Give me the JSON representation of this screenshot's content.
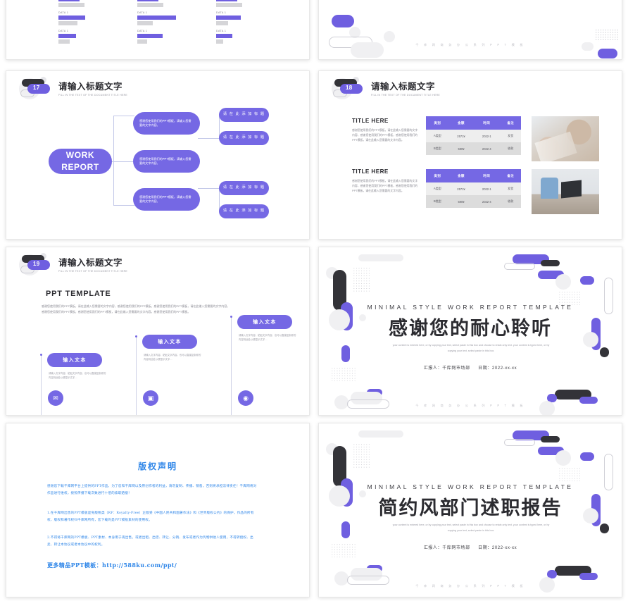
{
  "deck": {
    "footer_brand": "千 库 网 商 务 办 公 系 列 P P T 模 板"
  },
  "slide_chart": {
    "groups": [
      {
        "label": "DATA 1",
        "purple_pct": 52,
        "gray_pct": 36
      },
      {
        "label": "DATA 1",
        "purple_pct": 74,
        "gray_pct": 30
      },
      {
        "label": "DATA 1",
        "purple_pct": 47,
        "gray_pct": 23
      }
    ]
  },
  "slide17": {
    "number": "17",
    "title": "请输入标题文字",
    "subtitle": "FILL IN THE TEXT OF THE DOCUMENT TITLE HERE",
    "root": "WORK REPORT",
    "branches": [
      {
        "text": "感谢您使用我们的PPT模板，请输入您需要的文字内容。",
        "leaves": [
          "请 在 此 添 加 标 题",
          "请 在 此 添 加 标 题"
        ]
      },
      {
        "text": "感谢您使用我们的PPT模板，请输入您需要的文字内容。",
        "leaves": []
      },
      {
        "text": "感谢您使用我们的PPT模板，请输入您需要的文字内容。",
        "leaves": [
          "请 在 此 添 加 标 题",
          "请 在 此 添 加 标 题"
        ]
      }
    ]
  },
  "slide18": {
    "number": "18",
    "title": "请输入标题文字",
    "subtitle": "FILL IN THE TEXT OF THE DOCUMENT TITLE HERE",
    "blocks": [
      {
        "heading": "TITLE HERE",
        "paragraph": "感谢您使用我们的PPT模板，请在此输入您需要的文字内容，感谢您使用我们的PPT模板，感谢您使用我们的PPT模板，请在此输入您需要的文字内容。",
        "table": {
          "headers": [
            "类别",
            "金额",
            "时间",
            "备注"
          ],
          "rows": [
            [
              "A类型",
              "2571¥",
              "2022-1",
              "发货"
            ],
            [
              "B类型",
              "590¥",
              "2022-4",
              "收款"
            ]
          ]
        }
      },
      {
        "heading": "TITLE HERE",
        "paragraph": "感谢您使用我们的PPT模板，请在此输入您需要的文字内容，感谢您使用我们的PPT模板，感谢您使用我们的PPT模板，请在此输入您需要的文字内容。",
        "table": {
          "headers": [
            "类别",
            "金额",
            "时间",
            "备注"
          ],
          "rows": [
            [
              "A类型",
              "2571¥",
              "2022-1",
              "发货"
            ],
            [
              "B类型",
              "590¥",
              "2022-4",
              "收款"
            ]
          ]
        }
      }
    ]
  },
  "slide19": {
    "number": "19",
    "title": "请输入标题文字",
    "subtitle": "FILL IN THE TEXT OF THE DOCUMENT TITLE HERE",
    "heading": "PPT TEMPLATE",
    "paragraph": "感谢您使用我们的PPT模板，请在此输入您需要的文字内容，感谢您使用我们的PPT模板。感谢您使用我们的PPT模板，请在此输入您需要的文字内容，感谢您使用我们的PPT模板，感谢您使用我们的PPT模板，请在此输入您需要的文字内容，感谢您使用我们的PPT模板。",
    "items": [
      {
        "pill": "输入文本",
        "desc": "请输入文字内容、粘贴文字内容，也可以直接复制你的内容到此处以便显示文字…",
        "icon": "envelope-icon",
        "glyph": "✉"
      },
      {
        "pill": "输入文本",
        "desc": "请输入文字内容、粘贴文字内容，也可以直接复制你的内容到此处以便显示文字…",
        "icon": "briefcase-icon",
        "glyph": "▣"
      },
      {
        "pill": "输入文本",
        "desc": "请输入文字内容、粘贴文字内容，也可以直接复制你的内容到此处以便显示文字…",
        "icon": "target-icon",
        "glyph": "◉"
      }
    ]
  },
  "thanks_slide": {
    "eyebrow": "MINIMAL STYLE WORK REPORT TEMPLATE",
    "main": "感谢您的耐心聆听",
    "english": "your content is entered here, or by copying your text, select paste in this box and choose to retain only text. your content is typed here, or by copying your text, select paste in this box.",
    "reporter_label": "汇报人：",
    "reporter": "千库网市场部",
    "date_label": "日期：",
    "date": "2022-xx-xx",
    "footer": "千 库 网 商 务 办 公 系 列 P P T 模 板"
  },
  "cover_slide": {
    "eyebrow": "MINIMAL STYLE WORK REPORT TEMPLATE",
    "main": "简约风部门述职报告",
    "english": "your content is entered here, or by copying your text, select paste in this box and choose to retain only text. your content is typed here, or by copying your text, select paste in this box.",
    "reporter_label": "汇报人：",
    "reporter": "千库网市场部",
    "date_label": "日期：",
    "date": "2022-xx-xx",
    "footer": "千 库 网 商 务 办 公 系 列 P P T 模 板"
  },
  "copyright_slide": {
    "title": "版权声明",
    "paragraph1": "感谢您下载千库网平台上提供的PPT作品，为了您和千库网以及原创作者的利益，请勿复制、传播、销售，否则将承担法律责任！千库网将对作品进行维权，按照传播下载次数进行十倍的索取赔偿！",
    "paragraph2": "1.在千库网出售的PPT模板是免版税类（RF：Royalty-Free）正版受《中国人民共和国著作法》和《世界版权公约》的保护，作品的所有权、版权和著作权归千库网所有，您下载的是PPT模板素材的使用权。",
    "paragraph3": "2.不得将千库网的PPT模板、PPT素材、本身用于再出售，或者出租、出借、转让、分销、发布或者作为凭物供他人使用，不得转授权、出卖、转让本协议或者本协议中的权利。",
    "link_label": "更多精品PPT模板：",
    "link_url": "http://588ku.com/ppt/"
  },
  "colors": {
    "purple": "#7568e4",
    "dark": "#333338",
    "gray": "#eeeeee",
    "link_blue": "#2f86e8"
  }
}
